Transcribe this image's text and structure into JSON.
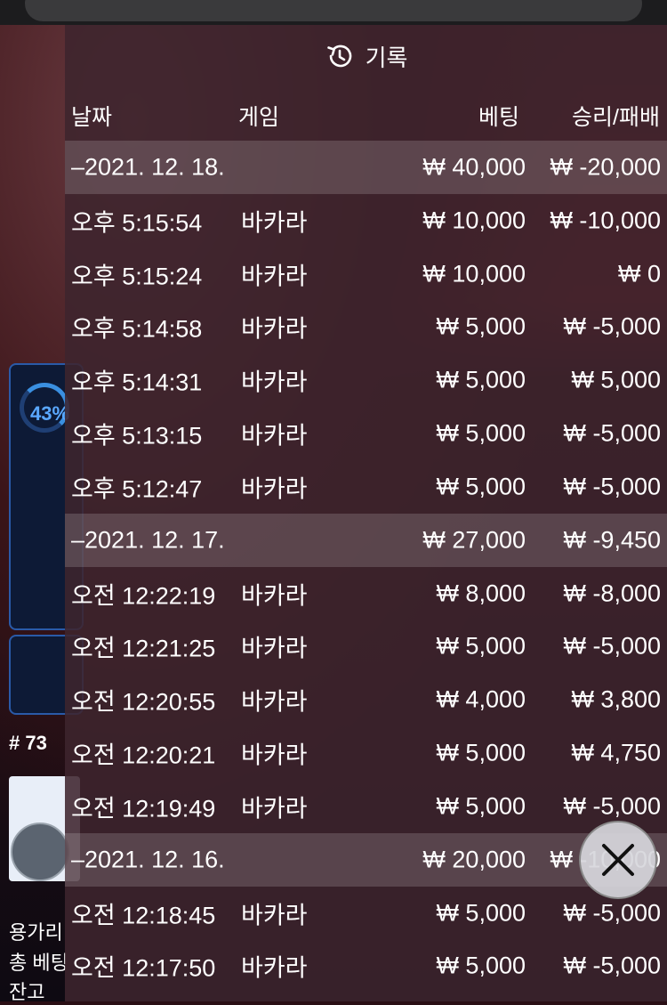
{
  "background": {
    "progress_pct": "43%",
    "round_number": "# 73",
    "text_lines": [
      "용가리",
      "총 베팅",
      "잔고"
    ]
  },
  "panel": {
    "title": "기록",
    "columns": {
      "date": "날짜",
      "game": "게임",
      "bet": "베팅",
      "result": "승리/패배"
    },
    "groups": [
      {
        "date": "–2021. 12. 18.",
        "bet": "₩ 40,000",
        "result": "₩ -20,000",
        "rows": [
          {
            "time": "오후 5:15:54",
            "game": "바카라",
            "bet": "₩ 10,000",
            "result": "₩ -10,000"
          },
          {
            "time": "오후 5:15:24",
            "game": "바카라",
            "bet": "₩ 10,000",
            "result": "₩ 0"
          },
          {
            "time": "오후 5:14:58",
            "game": "바카라",
            "bet": "₩ 5,000",
            "result": "₩ -5,000"
          },
          {
            "time": "오후 5:14:31",
            "game": "바카라",
            "bet": "₩ 5,000",
            "result": "₩ 5,000"
          },
          {
            "time": "오후 5:13:15",
            "game": "바카라",
            "bet": "₩ 5,000",
            "result": "₩ -5,000"
          },
          {
            "time": "오후 5:12:47",
            "game": "바카라",
            "bet": "₩ 5,000",
            "result": "₩ -5,000"
          }
        ]
      },
      {
        "date": "–2021. 12. 17.",
        "bet": "₩ 27,000",
        "result": "₩ -9,450",
        "rows": [
          {
            "time": "오전 12:22:19",
            "game": "바카라",
            "bet": "₩ 8,000",
            "result": "₩ -8,000"
          },
          {
            "time": "오전 12:21:25",
            "game": "바카라",
            "bet": "₩ 5,000",
            "result": "₩ -5,000"
          },
          {
            "time": "오전 12:20:55",
            "game": "바카라",
            "bet": "₩ 4,000",
            "result": "₩ 3,800"
          },
          {
            "time": "오전 12:20:21",
            "game": "바카라",
            "bet": "₩ 5,000",
            "result": "₩ 4,750"
          },
          {
            "time": "오전 12:19:49",
            "game": "바카라",
            "bet": "₩ 5,000",
            "result": "₩ -5,000"
          }
        ]
      },
      {
        "date": "–2021. 12. 16.",
        "bet": "₩ 20,000",
        "result": "₩ -10,000",
        "rows": [
          {
            "time": "오전 12:18:45",
            "game": "바카라",
            "bet": "₩ 5,000",
            "result": "₩ -5,000"
          },
          {
            "time": "오전 12:17:50",
            "game": "바카라",
            "bet": "₩ 5,000",
            "result": "₩ -5,000"
          }
        ]
      }
    ]
  },
  "icons": {
    "history": "history-icon",
    "close": "close-icon"
  }
}
